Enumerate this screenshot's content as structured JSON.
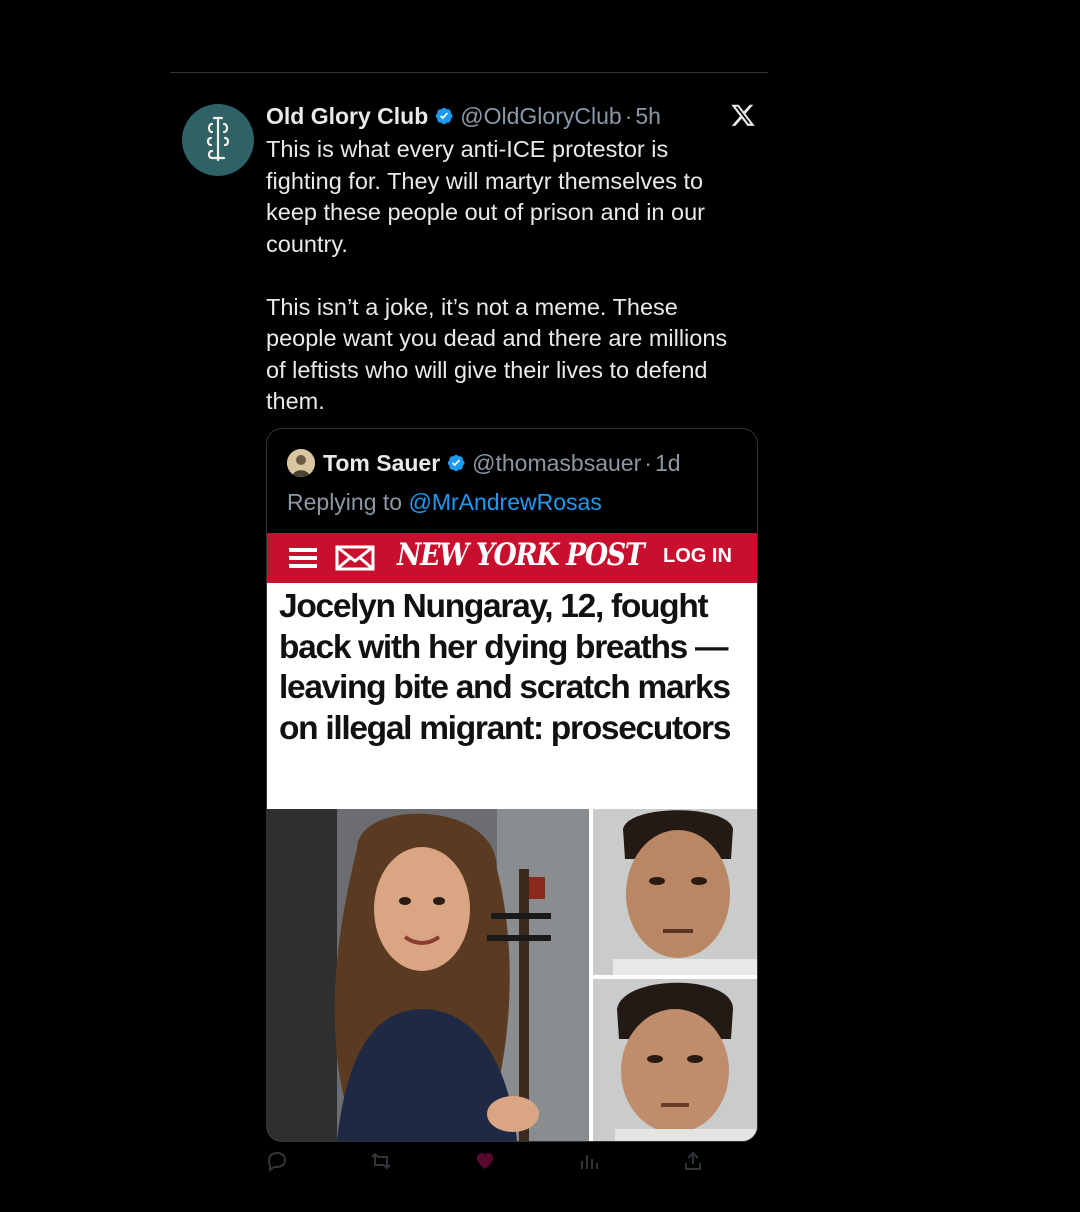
{
  "tweet": {
    "author_name": "Old Glory Club",
    "handle": "@OldGloryClub",
    "separator": "·",
    "time": "5h",
    "avatar_icon": "ogc-monogram-icon",
    "text": "This is what every anti-ICE protestor is\nfighting for. They will martyr themselves to\nkeep these people out of prison and in our\ncountry.\n\nThis isn’t a joke, it’s not a meme. These\npeople want you dead and there are millions\nof leftists who will give their lives to defend\nthem."
  },
  "quote": {
    "author_name": "Tom Sauer",
    "handle": "@thomasbsauer",
    "separator": "·",
    "time": "1d",
    "replying_prefix": "Replying to ",
    "replying_to": "@MrAndrewRosas",
    "article": {
      "publication": "NEW YORK POST",
      "login_label": "LOG IN",
      "headline": "Jocelyn Nungaray, 12, fought back with her dying breaths — leaving bite and scratch marks on illegal migrant: prosecutors"
    }
  },
  "colors": {
    "background": "#000000",
    "link": "#1d9bf0",
    "verified": "#1d9bf0",
    "nyp_red": "#c8102e",
    "muted_text": "#8b98a5"
  },
  "icons": [
    "verified-badge-icon",
    "x-logo-icon",
    "menu-icon",
    "mail-icon",
    "reply-icon",
    "retweet-icon",
    "like-icon",
    "views-icon",
    "share-icon"
  ]
}
